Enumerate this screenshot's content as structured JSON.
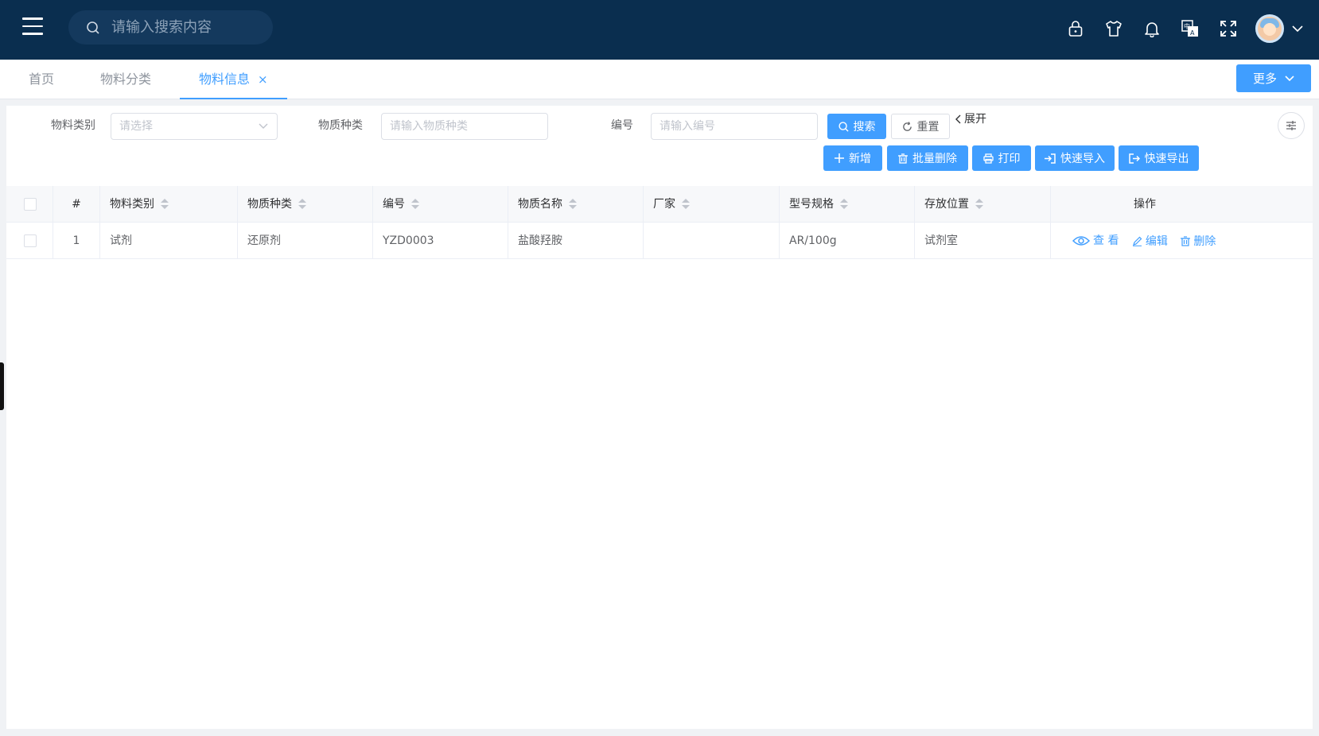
{
  "header": {
    "search_placeholder": "请输入搜索内容"
  },
  "tabs": [
    {
      "label": "首页"
    },
    {
      "label": "物料分类"
    },
    {
      "label": "物料信息",
      "close": "×"
    }
  ],
  "more_button": "更多",
  "filters": {
    "category_label": "物料类别",
    "category_placeholder": "请选择",
    "kind_label": "物质种类",
    "kind_placeholder": "请输入物质种类",
    "code_label": "编号",
    "code_placeholder": "请输入编号",
    "search_button": "搜索",
    "reset_button": "重置",
    "expand_link": "展开"
  },
  "toolbar": {
    "add": "新增",
    "batch_delete": "批量删除",
    "print": "打印",
    "quick_import": "快速导入",
    "quick_export": "快速导出"
  },
  "table": {
    "columns": [
      "#",
      "物料类别",
      "物质种类",
      "编号",
      "物质名称",
      "厂家",
      "型号规格",
      "存放位置",
      "操作"
    ],
    "rows": [
      {
        "index": "1",
        "category": "试剂",
        "kind": "还原剂",
        "code": "YZD0003",
        "name": "盐酸羟胺",
        "maker": "",
        "spec": "AR/100g",
        "location": "试剂室"
      }
    ],
    "actions": {
      "view": "查 看",
      "edit": "编辑",
      "delete": "删除"
    }
  },
  "colors": {
    "topbar": "#0a2e4f",
    "primary": "#409eff"
  }
}
